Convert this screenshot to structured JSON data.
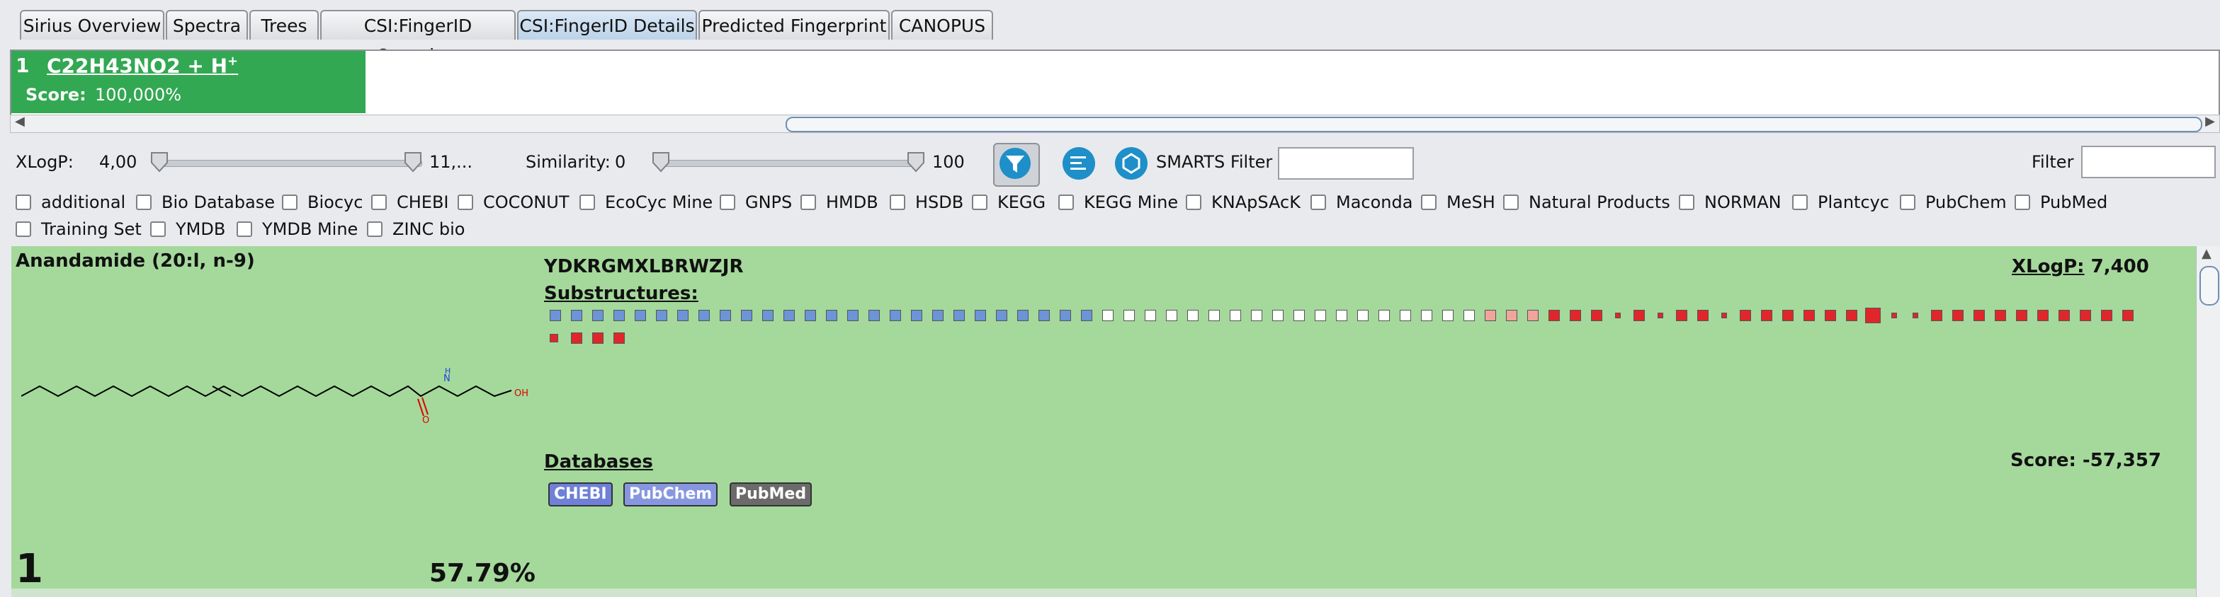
{
  "tabs": [
    {
      "label": "Sirius Overview"
    },
    {
      "label": "Spectra"
    },
    {
      "label": "Trees"
    },
    {
      "label": "CSI:FingerID Overview"
    },
    {
      "label": "CSI:FingerID Details"
    },
    {
      "label": "Predicted Fingerprint"
    },
    {
      "label": "CANOPUS"
    }
  ],
  "active_tab": "CSI:FingerID Details",
  "candidate": {
    "rank": "1",
    "formula": "C22H43NO2 + H",
    "formula_sup": "+",
    "score_label": "Score:",
    "score_value": "100,000%"
  },
  "toolbar": {
    "xlogp_label": "XLogP:",
    "xlogp_min": "4,00",
    "xlogp_max": "11,...",
    "similarity_label": "Similarity:",
    "similarity_min": "0",
    "similarity_max": "100",
    "smarts_label": "SMARTS Filter",
    "smarts_value": "",
    "filter_label": "Filter",
    "filter_value": ""
  },
  "databases_filter": [
    "additional",
    "Bio Database",
    "Biocyc",
    "CHEBI",
    "COCONUT",
    "EcoCyc Mine",
    "GNPS",
    "HMDB",
    "HSDB",
    "KEGG",
    "KEGG Mine",
    "KNApSAcK",
    "Maconda",
    "MeSH",
    "Natural Products",
    "NORMAN",
    "Plantcyc",
    "PubChem",
    "PubMed",
    "Training Set",
    "YMDB",
    "YMDB Mine",
    "ZINC bio"
  ],
  "result": {
    "name": "Anandamide (20:l, n-9)",
    "inchikey": "YDKRGMXLBRWZJR",
    "substructures_label": "Substructures:",
    "xlogp_label": "XLogP:",
    "xlogp_value": "7,400",
    "databases_label": "Databases",
    "score_text": "Score: -57,357",
    "rank": "1",
    "percent": "57.79%",
    "db_tags": [
      {
        "label": "CHEBI",
        "color": "#6f80d8"
      },
      {
        "label": "PubChem",
        "color": "#8797df"
      },
      {
        "label": "PubMed",
        "color": "#6b6b6b"
      }
    ],
    "structure_labels": {
      "n": "N",
      "h": "H",
      "o": "O",
      "oh": "OH"
    }
  },
  "colors": {
    "candidate_green": "#32a852",
    "card_green": "#a4d99b",
    "blue_sq": "#6c94d6",
    "white_sq": "#ffffff",
    "pink_sq": "#f0a49a",
    "red_sq": "#e0262a"
  }
}
